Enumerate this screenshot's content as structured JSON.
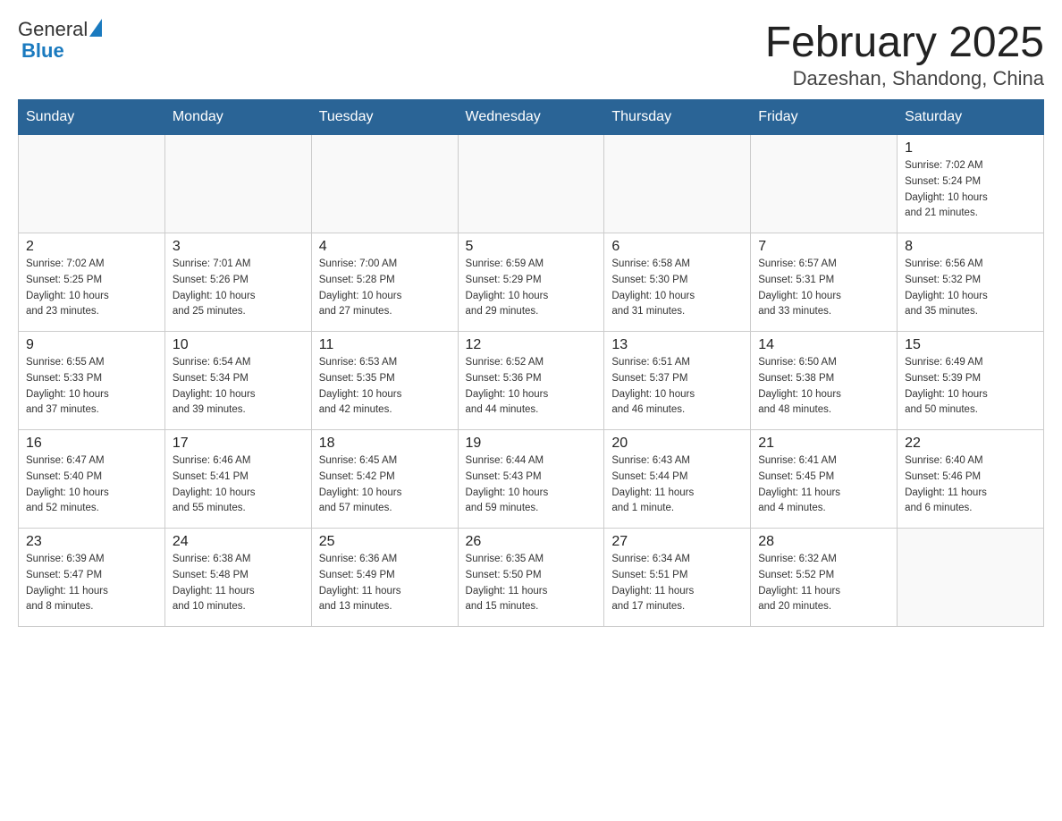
{
  "logo": {
    "general": "General",
    "blue": "Blue"
  },
  "title": "February 2025",
  "subtitle": "Dazeshan, Shandong, China",
  "days_of_week": [
    "Sunday",
    "Monday",
    "Tuesday",
    "Wednesday",
    "Thursday",
    "Friday",
    "Saturday"
  ],
  "weeks": [
    [
      {
        "day": "",
        "info": ""
      },
      {
        "day": "",
        "info": ""
      },
      {
        "day": "",
        "info": ""
      },
      {
        "day": "",
        "info": ""
      },
      {
        "day": "",
        "info": ""
      },
      {
        "day": "",
        "info": ""
      },
      {
        "day": "1",
        "info": "Sunrise: 7:02 AM\nSunset: 5:24 PM\nDaylight: 10 hours\nand 21 minutes."
      }
    ],
    [
      {
        "day": "2",
        "info": "Sunrise: 7:02 AM\nSunset: 5:25 PM\nDaylight: 10 hours\nand 23 minutes."
      },
      {
        "day": "3",
        "info": "Sunrise: 7:01 AM\nSunset: 5:26 PM\nDaylight: 10 hours\nand 25 minutes."
      },
      {
        "day": "4",
        "info": "Sunrise: 7:00 AM\nSunset: 5:28 PM\nDaylight: 10 hours\nand 27 minutes."
      },
      {
        "day": "5",
        "info": "Sunrise: 6:59 AM\nSunset: 5:29 PM\nDaylight: 10 hours\nand 29 minutes."
      },
      {
        "day": "6",
        "info": "Sunrise: 6:58 AM\nSunset: 5:30 PM\nDaylight: 10 hours\nand 31 minutes."
      },
      {
        "day": "7",
        "info": "Sunrise: 6:57 AM\nSunset: 5:31 PM\nDaylight: 10 hours\nand 33 minutes."
      },
      {
        "day": "8",
        "info": "Sunrise: 6:56 AM\nSunset: 5:32 PM\nDaylight: 10 hours\nand 35 minutes."
      }
    ],
    [
      {
        "day": "9",
        "info": "Sunrise: 6:55 AM\nSunset: 5:33 PM\nDaylight: 10 hours\nand 37 minutes."
      },
      {
        "day": "10",
        "info": "Sunrise: 6:54 AM\nSunset: 5:34 PM\nDaylight: 10 hours\nand 39 minutes."
      },
      {
        "day": "11",
        "info": "Sunrise: 6:53 AM\nSunset: 5:35 PM\nDaylight: 10 hours\nand 42 minutes."
      },
      {
        "day": "12",
        "info": "Sunrise: 6:52 AM\nSunset: 5:36 PM\nDaylight: 10 hours\nand 44 minutes."
      },
      {
        "day": "13",
        "info": "Sunrise: 6:51 AM\nSunset: 5:37 PM\nDaylight: 10 hours\nand 46 minutes."
      },
      {
        "day": "14",
        "info": "Sunrise: 6:50 AM\nSunset: 5:38 PM\nDaylight: 10 hours\nand 48 minutes."
      },
      {
        "day": "15",
        "info": "Sunrise: 6:49 AM\nSunset: 5:39 PM\nDaylight: 10 hours\nand 50 minutes."
      }
    ],
    [
      {
        "day": "16",
        "info": "Sunrise: 6:47 AM\nSunset: 5:40 PM\nDaylight: 10 hours\nand 52 minutes."
      },
      {
        "day": "17",
        "info": "Sunrise: 6:46 AM\nSunset: 5:41 PM\nDaylight: 10 hours\nand 55 minutes."
      },
      {
        "day": "18",
        "info": "Sunrise: 6:45 AM\nSunset: 5:42 PM\nDaylight: 10 hours\nand 57 minutes."
      },
      {
        "day": "19",
        "info": "Sunrise: 6:44 AM\nSunset: 5:43 PM\nDaylight: 10 hours\nand 59 minutes."
      },
      {
        "day": "20",
        "info": "Sunrise: 6:43 AM\nSunset: 5:44 PM\nDaylight: 11 hours\nand 1 minute."
      },
      {
        "day": "21",
        "info": "Sunrise: 6:41 AM\nSunset: 5:45 PM\nDaylight: 11 hours\nand 4 minutes."
      },
      {
        "day": "22",
        "info": "Sunrise: 6:40 AM\nSunset: 5:46 PM\nDaylight: 11 hours\nand 6 minutes."
      }
    ],
    [
      {
        "day": "23",
        "info": "Sunrise: 6:39 AM\nSunset: 5:47 PM\nDaylight: 11 hours\nand 8 minutes."
      },
      {
        "day": "24",
        "info": "Sunrise: 6:38 AM\nSunset: 5:48 PM\nDaylight: 11 hours\nand 10 minutes."
      },
      {
        "day": "25",
        "info": "Sunrise: 6:36 AM\nSunset: 5:49 PM\nDaylight: 11 hours\nand 13 minutes."
      },
      {
        "day": "26",
        "info": "Sunrise: 6:35 AM\nSunset: 5:50 PM\nDaylight: 11 hours\nand 15 minutes."
      },
      {
        "day": "27",
        "info": "Sunrise: 6:34 AM\nSunset: 5:51 PM\nDaylight: 11 hours\nand 17 minutes."
      },
      {
        "day": "28",
        "info": "Sunrise: 6:32 AM\nSunset: 5:52 PM\nDaylight: 11 hours\nand 20 minutes."
      },
      {
        "day": "",
        "info": ""
      }
    ]
  ]
}
